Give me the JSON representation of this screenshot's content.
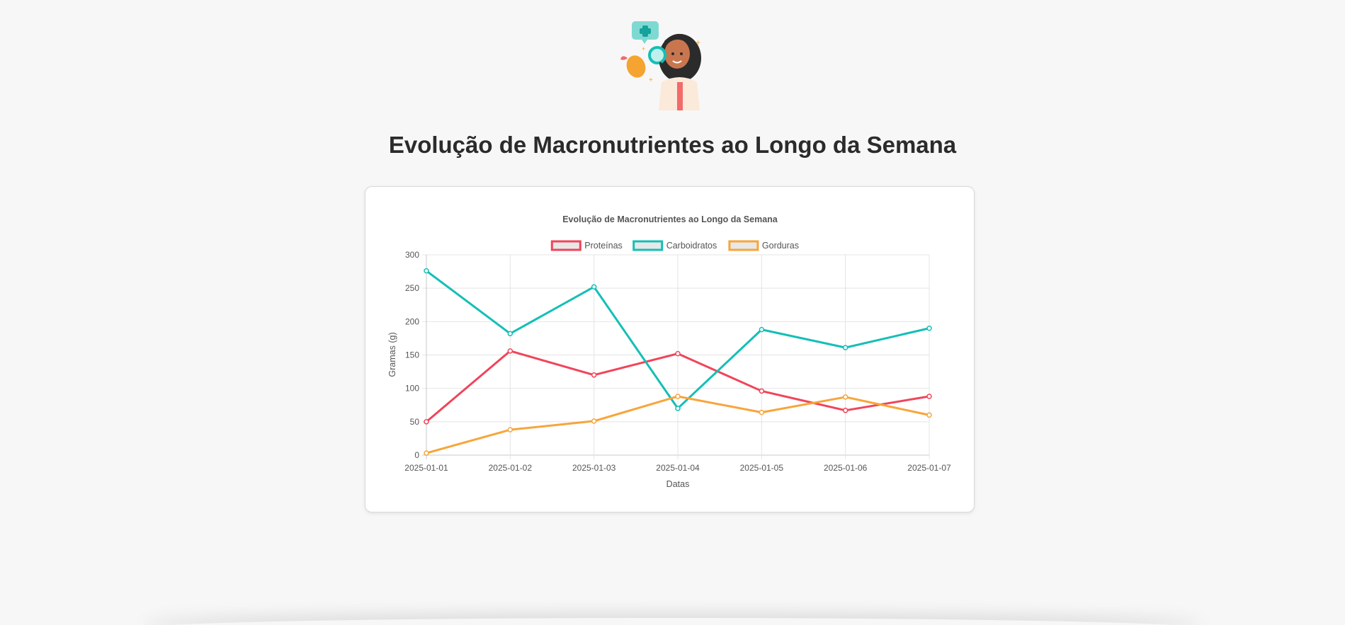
{
  "page": {
    "title": "Evolução de Macronutrientes ao Longo da Semana"
  },
  "illustration": {
    "icon": "nutritionist-with-magnifier-illustration"
  },
  "chart_data": {
    "type": "line",
    "title": "Evolução de Macronutrientes ao Longo da Semana",
    "xlabel": "Datas",
    "ylabel": "Gramas (g)",
    "ylim": [
      0,
      300
    ],
    "yticks": [
      0,
      50,
      100,
      150,
      200,
      250,
      300
    ],
    "grid": true,
    "legend_position": "top",
    "categories": [
      "2025-01-01",
      "2025-01-02",
      "2025-01-03",
      "2025-01-04",
      "2025-01-05",
      "2025-01-06",
      "2025-01-07"
    ],
    "series": [
      {
        "name": "Proteínas",
        "color": "#f0455a",
        "values": [
          50,
          156,
          120,
          152,
          96,
          67,
          88
        ]
      },
      {
        "name": "Carboidratos",
        "color": "#14bfb6",
        "values": [
          276,
          182,
          252,
          70,
          188,
          161,
          190
        ]
      },
      {
        "name": "Gorduras",
        "color": "#f7a53a",
        "values": [
          3,
          38,
          51,
          88,
          64,
          87,
          60
        ]
      }
    ]
  }
}
